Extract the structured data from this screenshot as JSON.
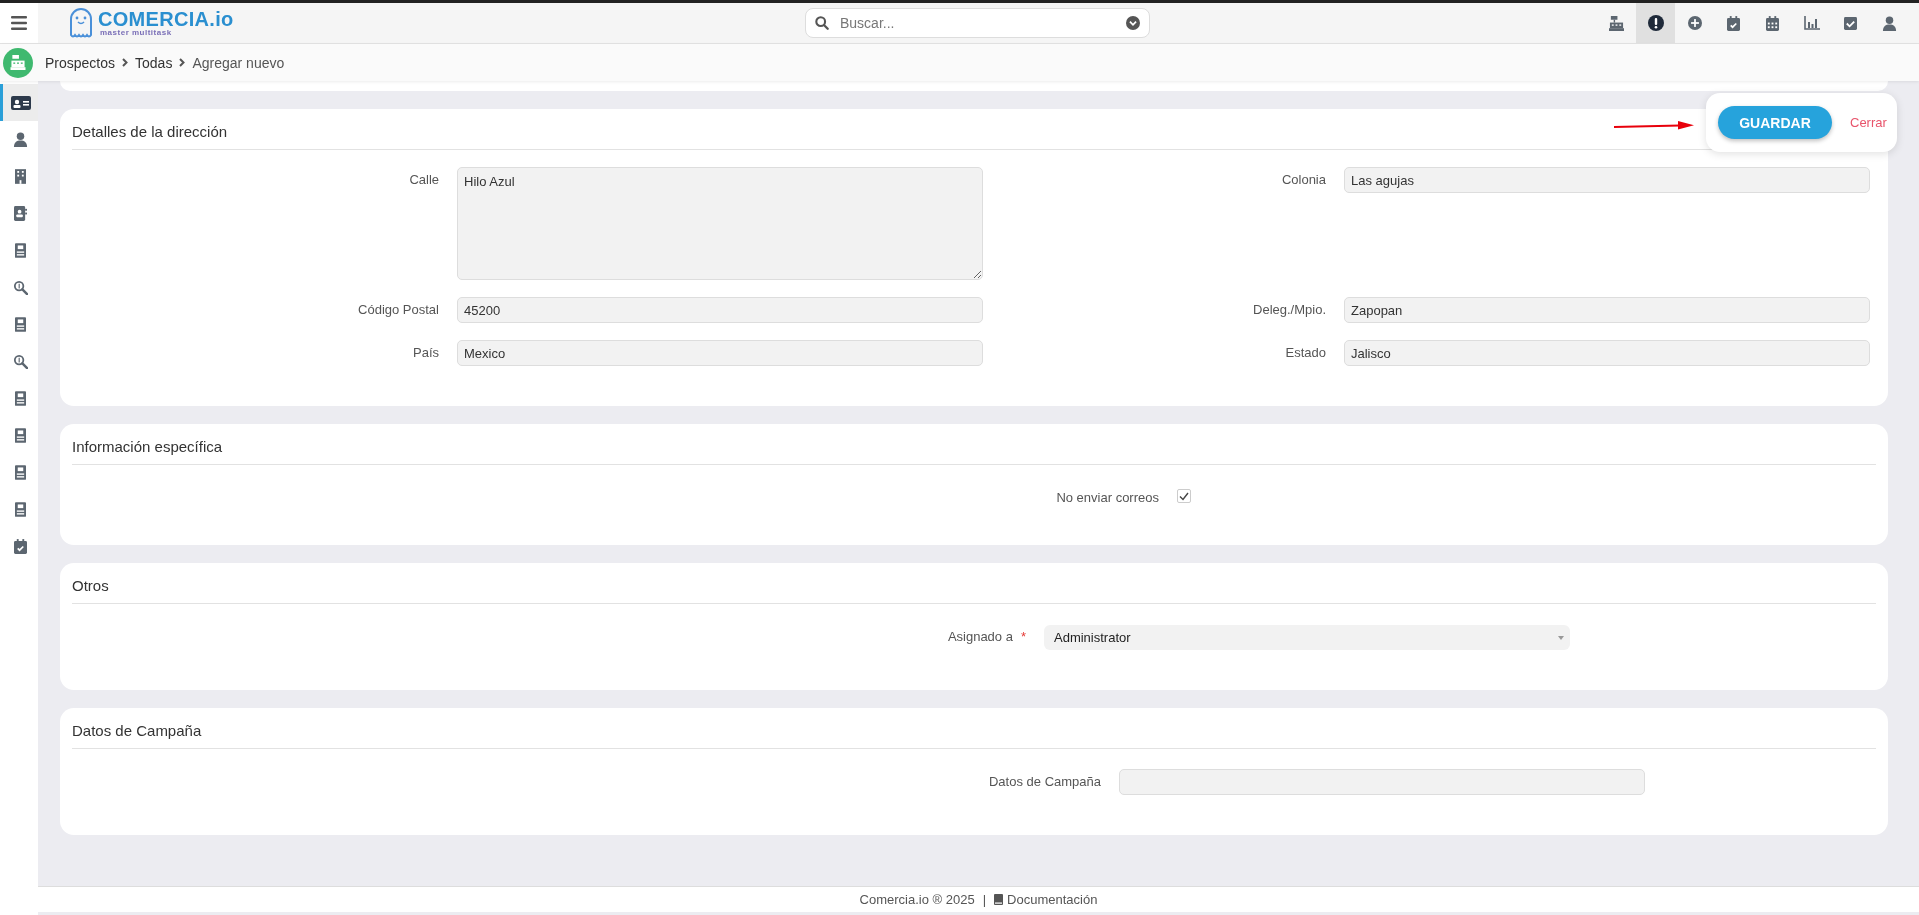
{
  "logo": {
    "name": "COMERCIA.io",
    "tagline": "master multitask"
  },
  "search": {
    "placeholder": "Buscar..."
  },
  "toolbar": [
    {
      "selected": false
    },
    {
      "selected": true
    },
    {
      "selected": false
    },
    {
      "selected": false
    },
    {
      "selected": false
    },
    {
      "selected": false
    },
    {
      "selected": false
    },
    {
      "selected": false
    }
  ],
  "breadcrumb": [
    "Prospectos",
    "Todas",
    "Agregar nuevo"
  ],
  "sidebar": {
    "items": [
      {
        "selected": true
      },
      {
        "selected": false
      },
      {
        "selected": false
      },
      {
        "selected": false
      },
      {
        "selected": false
      },
      {
        "selected": false
      },
      {
        "selected": false
      },
      {
        "selected": false
      },
      {
        "selected": false
      },
      {
        "selected": false
      },
      {
        "selected": false
      },
      {
        "selected": false
      },
      {
        "selected": false
      }
    ]
  },
  "actions": {
    "save": "GUARDAR",
    "close": "Cerrar"
  },
  "sections": [
    {
      "title": "Detalles de la dirección",
      "kind": "two_column",
      "fields": [
        {
          "label": "Calle",
          "kind": "textarea",
          "value": "Hilo Azul"
        },
        {
          "label": "Colonia",
          "kind": "text",
          "value": "Las agujas"
        },
        {
          "label": "Código Postal",
          "kind": "text",
          "value": "45200"
        },
        {
          "label": "Deleg./Mpio.",
          "kind": "text",
          "value": "Zapopan"
        },
        {
          "label": "País",
          "kind": "text",
          "value": "Mexico"
        },
        {
          "label": "Estado",
          "kind": "text",
          "value": "Jalisco"
        }
      ]
    },
    {
      "title": "Información específica",
      "kind": "single",
      "fields": [
        {
          "label": "No enviar correos",
          "kind": "checkbox",
          "checked": true
        }
      ]
    },
    {
      "title": "Otros",
      "kind": "single",
      "fields": [
        {
          "label": "Asignado a",
          "required_mark": "*",
          "kind": "select",
          "value": "Administrator"
        }
      ]
    },
    {
      "title": "Datos de Campaña",
      "kind": "single",
      "fields": [
        {
          "label": "Datos de Campaña",
          "kind": "text"
        }
      ]
    }
  ],
  "footer": {
    "copyright": "Comercia.io ® 2025",
    "separator": "|",
    "link": "Documentación"
  }
}
